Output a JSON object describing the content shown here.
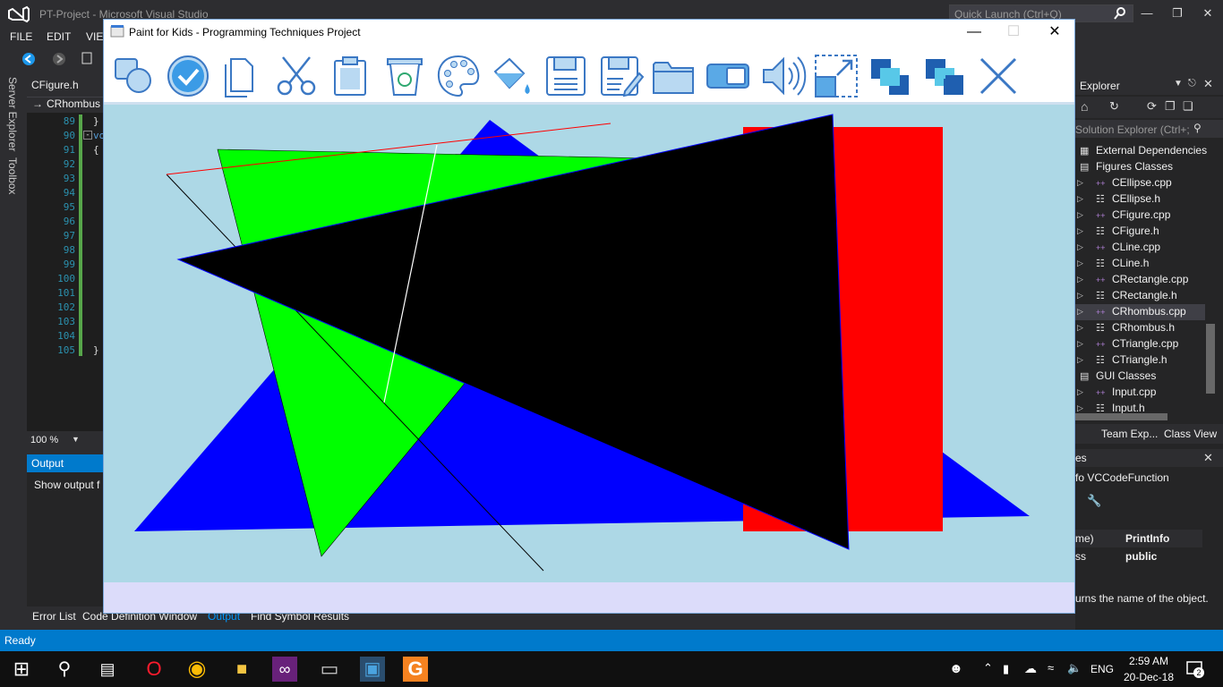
{
  "vs": {
    "title": "PT-Project - Microsoft Visual Studio",
    "quick_launch_placeholder": "Quick Launch (Ctrl+Q)",
    "menu": [
      "FILE",
      "EDIT",
      "VIEW"
    ],
    "side_tabs": [
      "Server Explorer",
      "Toolbox"
    ],
    "editor_tab": "CFigure.h",
    "nav_scope": "CRhombus",
    "line_numbers": [
      "89",
      "90",
      "91",
      "92",
      "93",
      "94",
      "95",
      "96",
      "97",
      "98",
      "99",
      "100",
      "101",
      "102",
      "103",
      "104",
      "105"
    ],
    "code_line_89": "}",
    "code_line_90": "vo",
    "code_line_91": "{",
    "code_line_105": "}",
    "zoom": "100 %",
    "output_title": "Output",
    "output_show": "Show output f",
    "bottom_tabs": [
      "Error List",
      "Code Definition Window",
      "Output",
      "Find Symbol Results"
    ],
    "status": "Ready",
    "solution_explorer": {
      "title": "Explorer",
      "search_placeholder": "Solution Explorer (Ctrl+;)",
      "items": [
        {
          "label": "External Dependencies",
          "icon": "dependencies-icon",
          "indent": 0
        },
        {
          "label": "Figures Classes",
          "icon": "folder-filter-icon",
          "indent": 0
        },
        {
          "label": "CEllipse.cpp",
          "icon": "cpp-file-icon",
          "indent": 1
        },
        {
          "label": "CEllipse.h",
          "icon": "header-file-icon",
          "indent": 1
        },
        {
          "label": "CFigure.cpp",
          "icon": "cpp-file-icon",
          "indent": 1
        },
        {
          "label": "CFigure.h",
          "icon": "header-file-icon",
          "indent": 1
        },
        {
          "label": "CLine.cpp",
          "icon": "cpp-file-icon",
          "indent": 1
        },
        {
          "label": "CLine.h",
          "icon": "header-file-icon",
          "indent": 1
        },
        {
          "label": "CRectangle.cpp",
          "icon": "cpp-file-icon",
          "indent": 1
        },
        {
          "label": "CRectangle.h",
          "icon": "header-file-icon",
          "indent": 1
        },
        {
          "label": "CRhombus.cpp",
          "icon": "cpp-file-icon",
          "indent": 1,
          "selected": true
        },
        {
          "label": "CRhombus.h",
          "icon": "header-file-icon",
          "indent": 1
        },
        {
          "label": "CTriangle.cpp",
          "icon": "cpp-file-icon",
          "indent": 1
        },
        {
          "label": "CTriangle.h",
          "icon": "header-file-icon",
          "indent": 1
        },
        {
          "label": "GUI Classes",
          "icon": "folder-filter-icon",
          "indent": 0
        },
        {
          "label": "Input.cpp",
          "icon": "cpp-file-icon",
          "indent": 1
        },
        {
          "label": "Input.h",
          "icon": "header-file-icon",
          "indent": 1
        }
      ],
      "tabs": [
        "Team Exp...",
        "Class View"
      ]
    },
    "properties": {
      "title": "es",
      "object": "fo  VCCodeFunction",
      "rows": [
        {
          "name": "me)",
          "value": "PrintInfo"
        },
        {
          "name": "ss",
          "value": "public"
        }
      ],
      "description": "urns the name of the object."
    }
  },
  "paint": {
    "title": "Paint for Kids - Programming Techniques Project",
    "tools": [
      "shapes-icon",
      "select-icon",
      "copy-icon",
      "cut-icon",
      "paste-icon",
      "delete-icon",
      "palette-icon",
      "fill-bucket-icon",
      "save-icon",
      "save-as-icon",
      "open-folder-icon",
      "toggle-mode-icon",
      "sound-icon",
      "resize-icon",
      "bring-front-icon",
      "send-back-icon",
      "exit-icon"
    ],
    "canvas_bg": "#add8e6",
    "status_bg": "#dcdcfa",
    "shape_colors": [
      "#0000ff",
      "#ff0000",
      "#00ff00",
      "#000000"
    ]
  },
  "taskbar": {
    "apps": [
      "start-icon",
      "search-icon",
      "task-view-icon",
      "opera-icon",
      "chrome-icon",
      "file-explorer-icon",
      "visual-studio-icon",
      "console-icon",
      "paint-app-icon",
      "pdf-icon"
    ],
    "lang": "ENG",
    "time": "2:59 AM",
    "date": "20-Dec-18",
    "notifications": "2"
  }
}
